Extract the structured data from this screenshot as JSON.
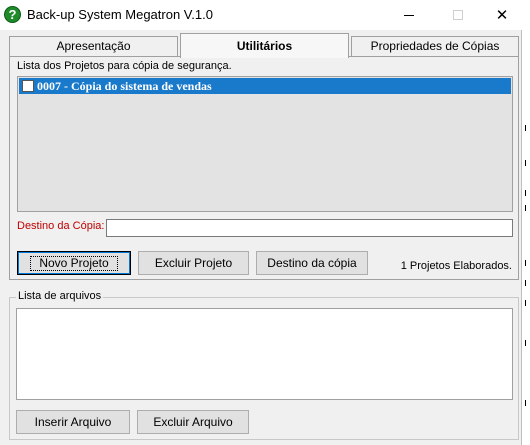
{
  "window": {
    "title": "Back-up System Megatron V.1.0",
    "icon": "question-icon",
    "controls": {
      "minimize": "minimize-icon",
      "maximize": "maximize-icon",
      "close": "✕"
    }
  },
  "tabs": [
    {
      "label": "Apresentação",
      "active": false
    },
    {
      "label": "Utilitários",
      "active": true
    },
    {
      "label": "Propriedades de Cópias",
      "active": false
    }
  ],
  "projects": {
    "label": "Lista dos Projetos para cópia de segurança.",
    "items": [
      {
        "text": "0007 - Cópia do sistema de vendas",
        "checked": false,
        "selected": true
      }
    ]
  },
  "destination": {
    "label": "Destino da Cópia:",
    "value": ""
  },
  "buttons": {
    "novo_projeto": "Novo Projeto",
    "excluir_projeto": "Excluir Projeto",
    "destino_copia": "Destino da cópia",
    "inserir_arquivo": "Inserir Arquivo",
    "excluir_arquivo": "Excluir Arquivo"
  },
  "status": {
    "count_text": "1 Projetos Elaborados."
  },
  "files": {
    "label": "Lista de arquivos",
    "items": []
  },
  "colors": {
    "selection": "#1979ca",
    "destination_label": "#c00000",
    "icon_green": "#1e8a2a"
  }
}
